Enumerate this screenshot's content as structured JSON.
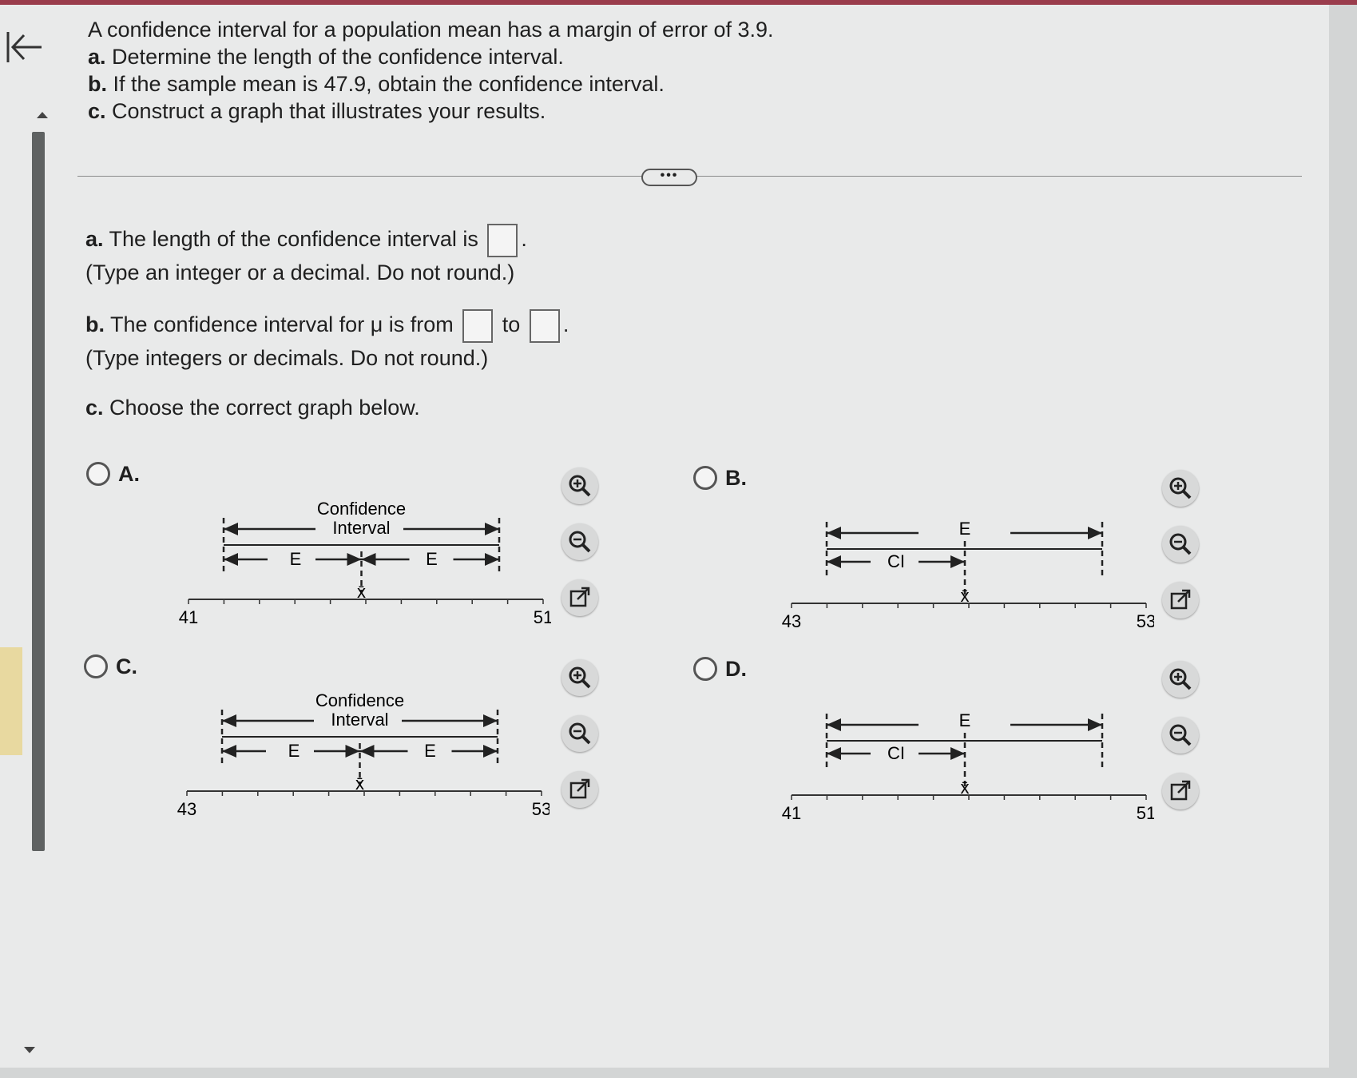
{
  "question": {
    "intro": "A confidence interval for a population mean has a margin of error of 3.9.",
    "a": {
      "label": "a.",
      "text": "Determine the length of the confidence interval."
    },
    "b": {
      "label": "b.",
      "text": "If the sample mean is 47.9, obtain the confidence interval."
    },
    "c": {
      "label": "c.",
      "text": "Construct a graph that illustrates your results."
    }
  },
  "more_button": "•••",
  "answers": {
    "a": {
      "label": "a.",
      "text": "The length of the confidence interval is",
      "end": ".",
      "hint": "(Type an integer or a decimal. Do not round.)"
    },
    "b": {
      "label": "b.",
      "text": "The confidence interval for μ is from",
      "mid": "to",
      "end": ".",
      "hint": "(Type integers or decimals. Do not round.)"
    },
    "c": {
      "label": "c.",
      "text": "Choose the correct graph below."
    }
  },
  "options": [
    {
      "label": "A.",
      "ci_label": "Confidence",
      "ci_label2": "Interval",
      "e_label": "E",
      "xbar": "x̄",
      "axis_min": "41",
      "axis_max": "51",
      "style": "ci_top"
    },
    {
      "label": "B.",
      "e_label": "E",
      "ci_label": "CI",
      "xbar": "x̄",
      "axis_min": "43",
      "axis_max": "53",
      "style": "e_top"
    },
    {
      "label": "C.",
      "ci_label": "Confidence",
      "ci_label2": "Interval",
      "e_label": "E",
      "xbar": "x̄",
      "axis_min": "43",
      "axis_max": "53",
      "style": "ci_top"
    },
    {
      "label": "D.",
      "e_label": "E",
      "ci_label": "CI",
      "xbar": "x̄",
      "axis_min": "41",
      "axis_max": "51",
      "style": "e_top"
    }
  ],
  "icons": {
    "zoom_in": "zoom-in-icon",
    "zoom_out": "zoom-out-icon",
    "popout": "external-link-icon",
    "back": "back-arrow-icon"
  }
}
